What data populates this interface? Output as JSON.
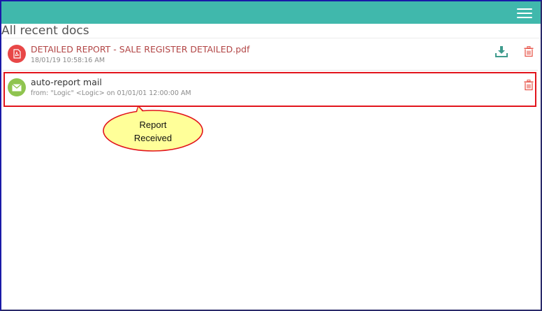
{
  "header": {
    "menu_icon": "hamburger-menu-icon",
    "bar_color": "#40b8ac"
  },
  "page": {
    "title": "All recent docs"
  },
  "documents": [
    {
      "icon": "pdf-file-icon",
      "name": "DETAILED REPORT - SALE REGISTER DETAILED.pdf",
      "meta": "18/01/19 10:58:16 AM",
      "actions": [
        "download-icon",
        "trash-icon"
      ],
      "name_color": "#b24646",
      "icon_color": "#e84747"
    },
    {
      "icon": "envelope-icon",
      "name": "auto-report mail",
      "meta": "from: \"Logic\" <Logic> on 01/01/01 12:00:00 AM",
      "actions": [
        "trash-icon"
      ],
      "name_color": "#333333",
      "icon_color": "#8fc44f"
    }
  ],
  "annotation": {
    "line1": "Report",
    "line2": "Received",
    "fill_color": "#ffff99",
    "border_color": "#e2141c"
  }
}
